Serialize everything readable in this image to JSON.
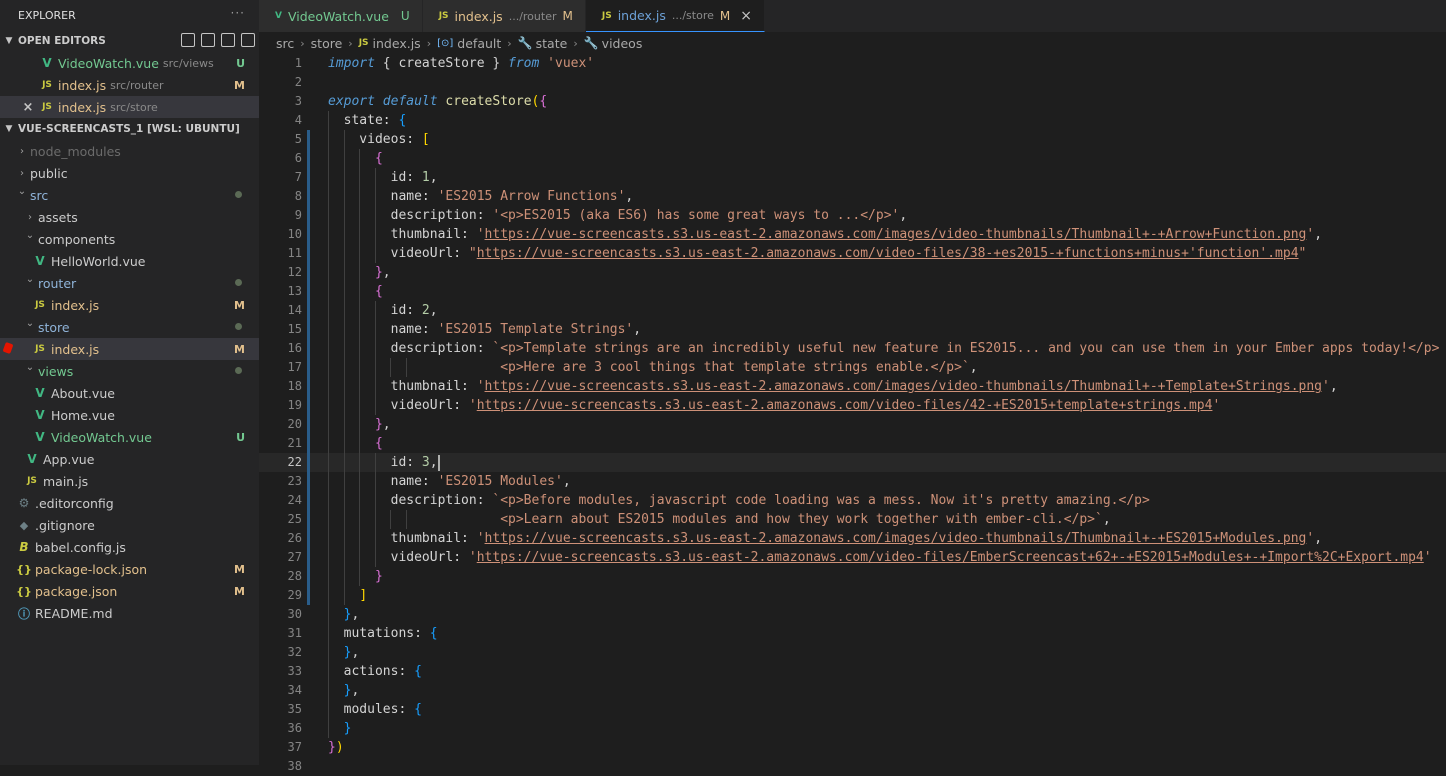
{
  "explorer": {
    "title": "EXPLORER",
    "more": "···",
    "open_editors_header": "OPEN EDITORS",
    "open_editors": [
      {
        "name": "VideoWatch.vue",
        "path": "src/views",
        "badge": "U",
        "type": "vue",
        "close": ""
      },
      {
        "name": "index.js",
        "path": "src/router",
        "badge": "M",
        "type": "js",
        "close": ""
      },
      {
        "name": "index.js",
        "path": "src/store",
        "badge": "",
        "type": "js",
        "close": "×"
      }
    ],
    "project_header": "VUE-SCREENCASTS_1 [WSL: UBUNTU]",
    "tree": [
      {
        "name": "node_modules",
        "depth": 0,
        "kind": "folder-closed",
        "color": "dim",
        "badge": ""
      },
      {
        "name": "public",
        "depth": 0,
        "kind": "folder-closed",
        "color": "plain",
        "badge": ""
      },
      {
        "name": "src",
        "depth": 0,
        "kind": "folder-open",
        "color": "modfolder",
        "badge": "dot"
      },
      {
        "name": "assets",
        "depth": 1,
        "kind": "folder-closed",
        "color": "plain",
        "badge": ""
      },
      {
        "name": "components",
        "depth": 1,
        "kind": "folder-open",
        "color": "plain",
        "badge": ""
      },
      {
        "name": "HelloWorld.vue",
        "depth": 2,
        "kind": "vue",
        "color": "plain",
        "badge": ""
      },
      {
        "name": "router",
        "depth": 1,
        "kind": "folder-open",
        "color": "modfolder",
        "badge": "dot"
      },
      {
        "name": "index.js",
        "depth": 2,
        "kind": "js",
        "color": "yellow",
        "badge": "M"
      },
      {
        "name": "store",
        "depth": 1,
        "kind": "folder-open",
        "color": "modfolder",
        "badge": "dot"
      },
      {
        "name": "index.js",
        "depth": 2,
        "kind": "js",
        "color": "yellow",
        "badge": "M",
        "active": true,
        "breakpoint": true
      },
      {
        "name": "views",
        "depth": 1,
        "kind": "folder-open",
        "color": "green",
        "badge": "dot"
      },
      {
        "name": "About.vue",
        "depth": 2,
        "kind": "vue",
        "color": "plain",
        "badge": ""
      },
      {
        "name": "Home.vue",
        "depth": 2,
        "kind": "vue",
        "color": "plain",
        "badge": ""
      },
      {
        "name": "VideoWatch.vue",
        "depth": 2,
        "kind": "vue",
        "color": "green",
        "badge": "U"
      },
      {
        "name": "App.vue",
        "depth": 1,
        "kind": "vue",
        "color": "plain",
        "badge": ""
      },
      {
        "name": "main.js",
        "depth": 1,
        "kind": "js",
        "color": "plain",
        "badge": ""
      },
      {
        "name": ".editorconfig",
        "depth": 0,
        "kind": "gear",
        "color": "plain",
        "badge": ""
      },
      {
        "name": ".gitignore",
        "depth": 0,
        "kind": "git",
        "color": "plain",
        "badge": ""
      },
      {
        "name": "babel.config.js",
        "depth": 0,
        "kind": "babel",
        "color": "plain",
        "badge": ""
      },
      {
        "name": "package-lock.json",
        "depth": 0,
        "kind": "json",
        "color": "yellow",
        "badge": "M"
      },
      {
        "name": "package.json",
        "depth": 0,
        "kind": "json",
        "color": "yellow",
        "badge": "M"
      },
      {
        "name": "README.md",
        "depth": 0,
        "kind": "info",
        "color": "plain",
        "badge": ""
      }
    ]
  },
  "tabs": [
    {
      "name": "VideoWatch.vue",
      "path": "",
      "badge": "U",
      "type": "vue",
      "active": false
    },
    {
      "name": "index.js",
      "path": ".../router",
      "badge": "M",
      "type": "js",
      "active": false
    },
    {
      "name": "index.js",
      "path": ".../store",
      "badge": "M",
      "type": "js",
      "active": true,
      "close": "×"
    }
  ],
  "breadcrumb": {
    "parts": [
      "src",
      "store",
      "index.js",
      "default",
      "state",
      "videos"
    ]
  },
  "editor": {
    "current_line": 22,
    "lines": [
      [
        [
          "kw",
          "import"
        ],
        [
          "p",
          " { "
        ],
        [
          "v",
          "createStore"
        ],
        [
          "p",
          " } "
        ],
        [
          "kw",
          "from"
        ],
        [
          "p",
          " "
        ],
        [
          "s",
          "'vuex'"
        ]
      ],
      [],
      [
        [
          "kw",
          "export"
        ],
        [
          "p",
          " "
        ],
        [
          "kw",
          "default"
        ],
        [
          "p",
          " "
        ],
        [
          "fn",
          "createStore"
        ],
        [
          "y",
          "("
        ],
        [
          "pu",
          "{"
        ]
      ],
      [
        [
          "p",
          "  state: "
        ],
        [
          "bl",
          "{"
        ]
      ],
      [
        [
          "p",
          "    videos: "
        ],
        [
          "y",
          "["
        ]
      ],
      [
        [
          "p",
          "      "
        ],
        [
          "pu",
          "{"
        ]
      ],
      [
        [
          "p",
          "        id: "
        ],
        [
          "n",
          "1"
        ],
        [
          "p",
          ","
        ]
      ],
      [
        [
          "p",
          "        name: "
        ],
        [
          "s",
          "'ES2015 Arrow Functions'"
        ],
        [
          "p",
          ","
        ]
      ],
      [
        [
          "p",
          "        description: "
        ],
        [
          "s",
          "'<p>ES2015 (aka ES6) has some great ways to ...</p>'"
        ],
        [
          "p",
          ","
        ]
      ],
      [
        [
          "p",
          "        thumbnail: "
        ],
        [
          "s",
          "'"
        ],
        [
          "u",
          "https://vue-screencasts.s3.us-east-2.amazonaws.com/images/video-thumbnails/Thumbnail+-+Arrow+Function.png"
        ],
        [
          "s",
          "'"
        ],
        [
          "p",
          ","
        ]
      ],
      [
        [
          "p",
          "        videoUrl: "
        ],
        [
          "s",
          "\""
        ],
        [
          "u",
          "https://vue-screencasts.s3.us-east-2.amazonaws.com/video-files/38-+es2015-+functions+minus+'function'.mp4"
        ],
        [
          "s",
          "\""
        ]
      ],
      [
        [
          "p",
          "      "
        ],
        [
          "pu",
          "}"
        ],
        [
          "p",
          ","
        ]
      ],
      [
        [
          "p",
          "      "
        ],
        [
          "pu",
          "{"
        ]
      ],
      [
        [
          "p",
          "        id: "
        ],
        [
          "n",
          "2"
        ],
        [
          "p",
          ","
        ]
      ],
      [
        [
          "p",
          "        name: "
        ],
        [
          "s",
          "'ES2015 Template Strings'"
        ],
        [
          "p",
          ","
        ]
      ],
      [
        [
          "p",
          "        description: "
        ],
        [
          "s",
          "`<p>Template strings are an incredibly useful new feature in ES2015... and you can use them in your Ember apps today!</p>"
        ]
      ],
      [
        [
          "p",
          "                      "
        ],
        [
          "s",
          "<p>Here are 3 cool things that template strings enable.</p>`"
        ],
        [
          "p",
          ","
        ]
      ],
      [
        [
          "p",
          "        thumbnail: "
        ],
        [
          "s",
          "'"
        ],
        [
          "u",
          "https://vue-screencasts.s3.us-east-2.amazonaws.com/images/video-thumbnails/Thumbnail+-+Template+Strings.png"
        ],
        [
          "s",
          "'"
        ],
        [
          "p",
          ","
        ]
      ],
      [
        [
          "p",
          "        videoUrl: "
        ],
        [
          "s",
          "'"
        ],
        [
          "u",
          "https://vue-screencasts.s3.us-east-2.amazonaws.com/video-files/42-+ES2015+template+strings.mp4"
        ],
        [
          "s",
          "'"
        ]
      ],
      [
        [
          "p",
          "      "
        ],
        [
          "pu",
          "}"
        ],
        [
          "p",
          ","
        ]
      ],
      [
        [
          "p",
          "      "
        ],
        [
          "pu",
          "{"
        ]
      ],
      [
        [
          "p",
          "        id: "
        ],
        [
          "n",
          "3"
        ],
        [
          "p",
          ","
        ],
        [
          "c",
          ""
        ]
      ],
      [
        [
          "p",
          "        name: "
        ],
        [
          "s",
          "'ES2015 Modules'"
        ],
        [
          "p",
          ","
        ]
      ],
      [
        [
          "p",
          "        description: "
        ],
        [
          "s",
          "`<p>Before modules, javascript code loading was a mess. Now it's pretty amazing.</p>"
        ]
      ],
      [
        [
          "p",
          "                      "
        ],
        [
          "s",
          "<p>Learn about ES2015 modules and how they work together with ember-cli.</p>`"
        ],
        [
          "p",
          ","
        ]
      ],
      [
        [
          "p",
          "        thumbnail: "
        ],
        [
          "s",
          "'"
        ],
        [
          "u",
          "https://vue-screencasts.s3.us-east-2.amazonaws.com/images/video-thumbnails/Thumbnail+-+ES2015+Modules.png"
        ],
        [
          "s",
          "'"
        ],
        [
          "p",
          ","
        ]
      ],
      [
        [
          "p",
          "        videoUrl: "
        ],
        [
          "s",
          "'"
        ],
        [
          "u",
          "https://vue-screencasts.s3.us-east-2.amazonaws.com/video-files/EmberScreencast+62+-+ES2015+Modules+-+Import%2C+Export.mp4"
        ],
        [
          "s",
          "'"
        ]
      ],
      [
        [
          "p",
          "      "
        ],
        [
          "pu",
          "}"
        ]
      ],
      [
        [
          "p",
          "    "
        ],
        [
          "y",
          "]"
        ]
      ],
      [
        [
          "p",
          "  "
        ],
        [
          "bl",
          "}"
        ],
        [
          "p",
          ","
        ]
      ],
      [
        [
          "p",
          "  mutations: "
        ],
        [
          "bl",
          "{"
        ]
      ],
      [
        [
          "p",
          "  "
        ],
        [
          "bl",
          "}"
        ],
        [
          "p",
          ","
        ]
      ],
      [
        [
          "p",
          "  actions: "
        ],
        [
          "bl",
          "{"
        ]
      ],
      [
        [
          "p",
          "  "
        ],
        [
          "bl",
          "}"
        ],
        [
          "p",
          ","
        ]
      ],
      [
        [
          "p",
          "  modules: "
        ],
        [
          "bl",
          "{"
        ]
      ],
      [
        [
          "p",
          "  "
        ],
        [
          "bl",
          "}"
        ]
      ],
      [
        [
          "pu",
          "}"
        ],
        [
          "y",
          ")"
        ]
      ],
      []
    ]
  }
}
